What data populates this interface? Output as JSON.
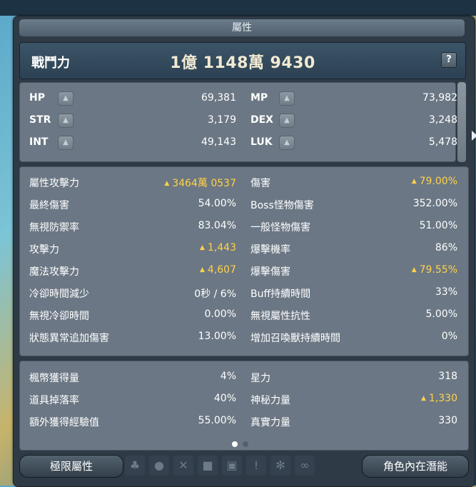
{
  "window": {
    "title": "屬性"
  },
  "power": {
    "label": "戰鬥力",
    "value": "1億 1148萬 9430",
    "help": "?"
  },
  "basic_stats": [
    {
      "name": "HP",
      "value": "69,381"
    },
    {
      "name": "MP",
      "value": "73,982"
    },
    {
      "name": "STR",
      "value": "3,179"
    },
    {
      "name": "DEX",
      "value": "3,248"
    },
    {
      "name": "INT",
      "value": "49,143"
    },
    {
      "name": "LUK",
      "value": "5,478"
    }
  ],
  "detail_stats": [
    {
      "label": "屬性攻擊力",
      "value": "3464萬 0537",
      "highlight": true
    },
    {
      "label": "傷害",
      "value": "79.00%",
      "highlight": true
    },
    {
      "label": "最終傷害",
      "value": "54.00%",
      "highlight": false
    },
    {
      "label": "Boss怪物傷害",
      "value": "352.00%",
      "highlight": false
    },
    {
      "label": "無視防禦率",
      "value": "83.04%",
      "highlight": false
    },
    {
      "label": "一般怪物傷害",
      "value": "51.00%",
      "highlight": false
    },
    {
      "label": "攻擊力",
      "value": "1,443",
      "highlight": true
    },
    {
      "label": "爆擊機率",
      "value": "86%",
      "highlight": false
    },
    {
      "label": "魔法攻擊力",
      "value": "4,607",
      "highlight": true
    },
    {
      "label": "爆擊傷害",
      "value": "79.55%",
      "highlight": true
    },
    {
      "label": "冷卻時間減少",
      "value": "0秒 / 6%",
      "highlight": false
    },
    {
      "label": "Buff持續時間",
      "value": "33%",
      "highlight": false
    },
    {
      "label": "無視冷卻時間",
      "value": "0.00%",
      "highlight": false
    },
    {
      "label": "無視屬性抗性",
      "value": "5.00%",
      "highlight": false
    },
    {
      "label": "狀態異常追加傷害",
      "value": "13.00%",
      "highlight": false
    },
    {
      "label": "增加召喚獸持續時間",
      "value": "0%",
      "highlight": false
    }
  ],
  "extra_stats": [
    {
      "label": "楓幣獲得量",
      "value": "4%",
      "highlight": false
    },
    {
      "label": "星力",
      "value": "318",
      "highlight": false
    },
    {
      "label": "道具掉落率",
      "value": "40%",
      "highlight": false
    },
    {
      "label": "神秘力量",
      "value": "1,330",
      "highlight": true
    },
    {
      "label": "額外獲得經驗值",
      "value": "55.00%",
      "highlight": false
    },
    {
      "label": "真實力量",
      "value": "330",
      "highlight": false
    }
  ],
  "pagination": {
    "current_page": 1,
    "total_pages": 2
  },
  "buttons": {
    "hyper_stats": "極限屬性",
    "inner_ability": "角色內在潛能"
  },
  "colors": {
    "highlight": "#ffd24a",
    "text": "#ffffff",
    "panel": "#6b7784",
    "frame": "#2e3a46"
  }
}
